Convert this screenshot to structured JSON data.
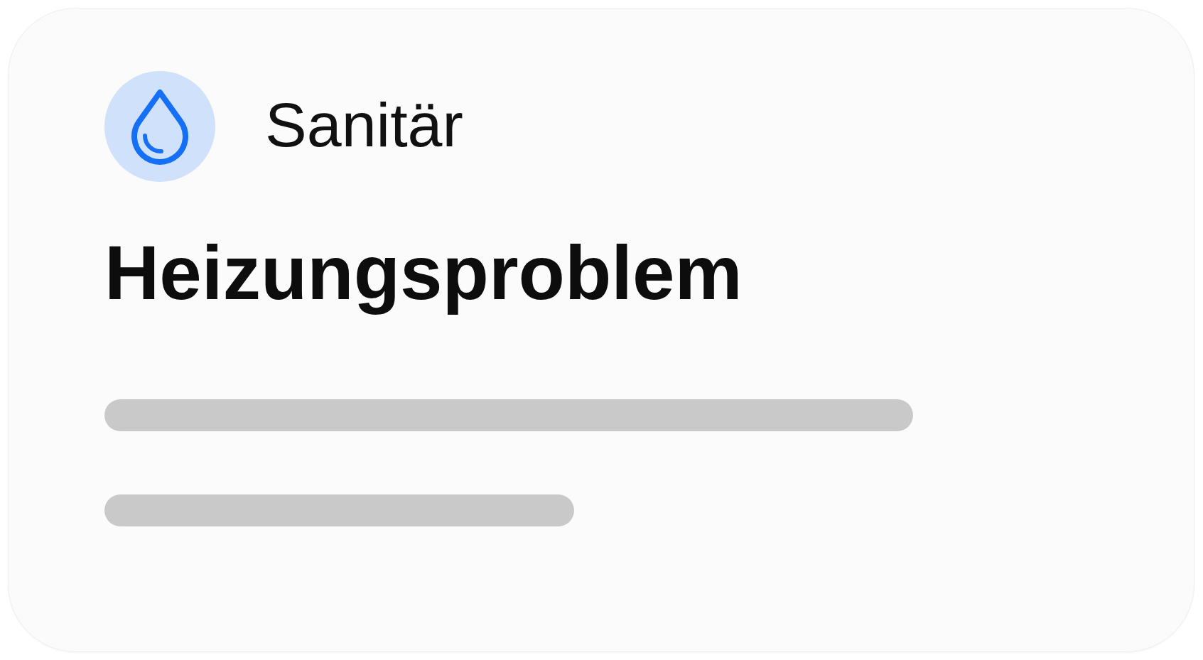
{
  "card": {
    "category": {
      "label": "Sanitär"
    },
    "title": "Heizungsproblem"
  }
}
